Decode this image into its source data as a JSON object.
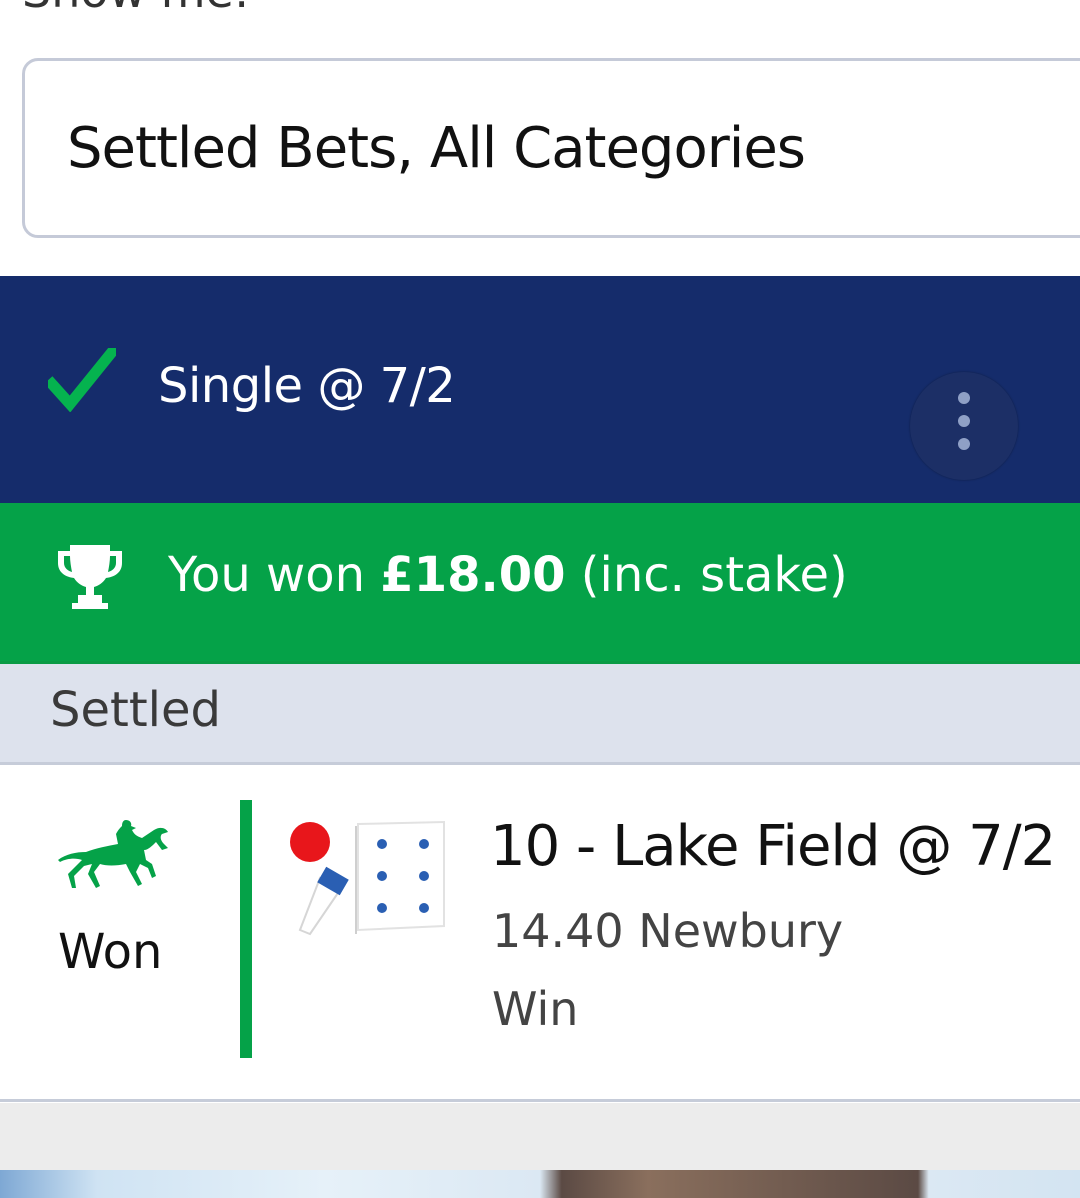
{
  "filter": {
    "label": "Show me:",
    "value": "Settled Bets, All Categories"
  },
  "bet": {
    "title": "Single @ 7/2",
    "status_icon": "check-icon",
    "more_icon": "more-vertical-icon"
  },
  "win_banner": {
    "prefix": "You won ",
    "amount": "£18.00",
    "suffix": " (inc. stake)",
    "icon": "trophy-icon"
  },
  "status": {
    "label": "Settled"
  },
  "selection": {
    "result": "Won",
    "name": "10 - Lake Field @ 7/2",
    "race": "14.40 Newbury",
    "market": "Win",
    "sport_icon": "horse-racing-icon",
    "silks_icon": "jockey-silks-icon"
  },
  "colors": {
    "header_bg": "#152c6b",
    "win_green": "#05a248",
    "status_bg": "#dde2ed"
  }
}
